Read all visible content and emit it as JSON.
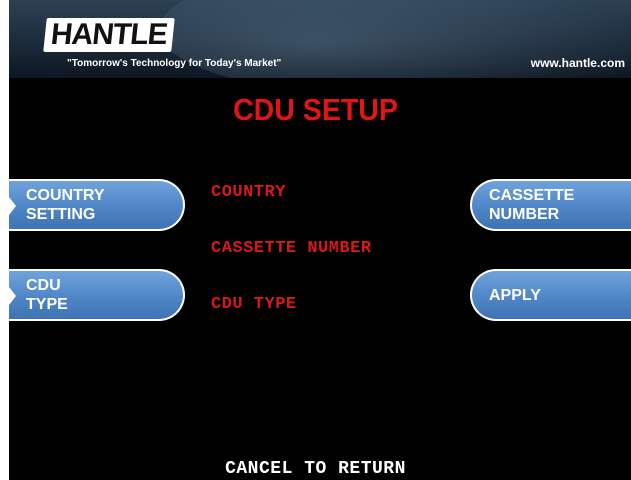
{
  "header": {
    "logo": "HANTLE",
    "tagline": "\"Tomorrow's Technology for Today's Market\"",
    "website": "www.hantle.com"
  },
  "screen": {
    "title": "CDU SETUP",
    "labels": [
      "COUNTRY",
      "CASSETTE NUMBER",
      "CDU TYPE"
    ],
    "footer": "CANCEL TO RETURN"
  },
  "buttons": {
    "country_setting": [
      "COUNTRY",
      "SETTING"
    ],
    "cdu_type": [
      "CDU",
      "TYPE"
    ],
    "cassette_number": [
      "CASSETTE",
      "NUMBER"
    ],
    "apply": "APPLY"
  },
  "colors": {
    "title": "#e01515",
    "labels": "#d61a1a",
    "button": "#4f86c6",
    "background": "#000000"
  }
}
